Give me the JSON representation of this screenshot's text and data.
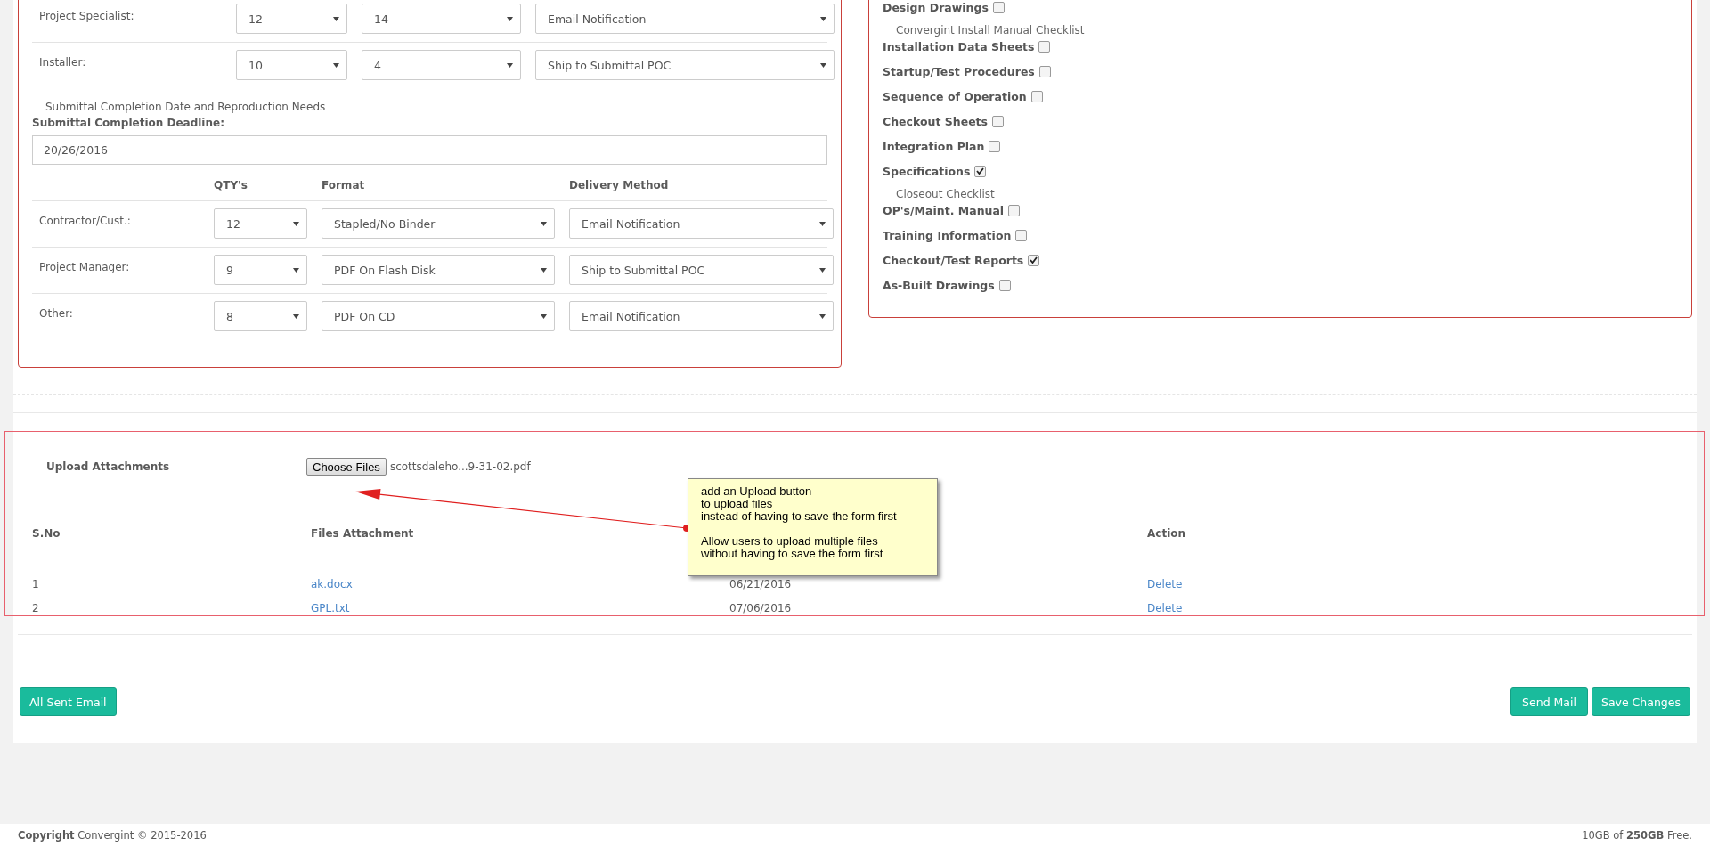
{
  "assignment_table": {
    "rows": [
      {
        "label": "Project Specialist:",
        "qty": "12",
        "format": "14",
        "delivery": "Email Notification"
      },
      {
        "label": "Installer:",
        "qty": "10",
        "format": "4",
        "delivery": "Ship to Submittal POC"
      }
    ]
  },
  "reproduction": {
    "section_title": "Submittal Completion Date and Reproduction Needs",
    "deadline_label": "Submittal Completion Deadline:",
    "deadline_value": "20/26/2016",
    "column_headers": [
      "QTY's",
      "Format",
      "Delivery Method"
    ],
    "rows": [
      {
        "label": "Contractor/Cust.:",
        "qty": "12",
        "format": "Stapled/No Binder",
        "delivery": "Email Notification"
      },
      {
        "label": "Project Manager:",
        "qty": "9",
        "format": "PDF On Flash Disk",
        "delivery": "Ship to Submittal POC"
      },
      {
        "label": "Other:",
        "qty": "8",
        "format": "PDF On CD",
        "delivery": "Email Notification"
      }
    ]
  },
  "checklist": {
    "items": [
      {
        "kind": "checkbox",
        "label": "Design Drawings",
        "checked": false
      },
      {
        "kind": "heading",
        "label": "Convergint Install Manual Checklist"
      },
      {
        "kind": "checkbox",
        "label": "Installation Data Sheets",
        "checked": false
      },
      {
        "kind": "checkbox",
        "label": "Startup/Test Procedures",
        "checked": false
      },
      {
        "kind": "checkbox",
        "label": "Sequence of Operation",
        "checked": false
      },
      {
        "kind": "checkbox",
        "label": "Checkout Sheets",
        "checked": false
      },
      {
        "kind": "checkbox",
        "label": "Integration Plan",
        "checked": false
      },
      {
        "kind": "checkbox",
        "label": "Specifications",
        "checked": true
      },
      {
        "kind": "heading",
        "label": "Closeout Checklist"
      },
      {
        "kind": "checkbox",
        "label": "OP's/Maint. Manual",
        "checked": false
      },
      {
        "kind": "checkbox",
        "label": "Training Information",
        "checked": false
      },
      {
        "kind": "checkbox",
        "label": "Checkout/Test Reports",
        "checked": true
      },
      {
        "kind": "checkbox",
        "label": "As-Built Drawings",
        "checked": false
      }
    ]
  },
  "attachments": {
    "label": "Upload Attachments",
    "button": "Choose Files",
    "file_name": "scottsdaleho...9-31-02.pdf",
    "columns": [
      "S.No",
      "Files Attachment",
      "Action"
    ],
    "rows": [
      {
        "number": "1",
        "file": "ak.docx",
        "date": "06/21/2016",
        "action": "Delete"
      },
      {
        "number": "2",
        "file": "GPL.txt",
        "date": "07/06/2016",
        "action": "Delete"
      }
    ]
  },
  "note": {
    "paragraphs": [
      "add an Upload button\nto upload files\ninstead of having to save the form first",
      "Allow users to upload multiple files\nwithout having to save the form first"
    ]
  },
  "buttons": {
    "left": [
      "All Sent Email"
    ],
    "right": [
      "Send Mail",
      "Save Changes"
    ]
  },
  "footer": {
    "copyright": "**Copyright** Convergint © 2015-2016",
    "storage": "10GB of **250GB** Free."
  }
}
